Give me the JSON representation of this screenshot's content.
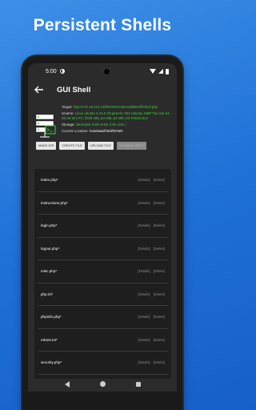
{
  "headline": "Persistent Shells",
  "status": {
    "time": "5:00"
  },
  "appbar": {
    "title": "GUI Shell"
  },
  "info": {
    "target_label": "Target:",
    "target_value": "http://172.16.110.130/DVWA/vulnerabilities/fi/shell.php",
    "uname_label": "Uname:",
    "uname_value": "Linux ubuntu 4.15.0-29-generic #31-Ubuntu SMP Tue Apr 24 06:16:19 UTC 2018 x86_64 x86_64 x86_64 GNU/Linux",
    "storage_label": "Storage:",
    "storage_value": "/dev/sda1 9.9G 9.6G 2.95 41% /",
    "location_label": "Current Location:",
    "location_value": "/var/www/html/DVWA"
  },
  "buttons": [
    {
      "label": "MAKE DIR"
    },
    {
      "label": "CREATE FILE"
    },
    {
      "label": "UPLOAD FILE"
    },
    {
      "label": "GO BACK ROOT"
    }
  ],
  "files": [
    {
      "name": "index.php*",
      "details": "[Details]",
      "delete": "[Delete]"
    },
    {
      "name": "instructions.php*",
      "details": "[Details]",
      "delete": "[Delete]"
    },
    {
      "name": "login.php*",
      "details": "[Details]",
      "delete": "[Delete]"
    },
    {
      "name": "logout.php*",
      "details": "[Details]",
      "delete": "[Delete]"
    },
    {
      "name": "misc.php*",
      "details": "[Details]",
      "delete": "[Delete]"
    },
    {
      "name": "php.ini*",
      "details": "[Details]",
      "delete": "[Delete]"
    },
    {
      "name": "phpinfo.php*",
      "details": "[Details]",
      "delete": "[Delete]"
    },
    {
      "name": "robots.txt*",
      "details": "[Details]",
      "delete": "[Delete]"
    },
    {
      "name": "security.php*",
      "details": "[Details]",
      "delete": "[Delete]"
    }
  ],
  "colors": {
    "background": "#1e6fd6",
    "accent_green": "#39d439"
  }
}
